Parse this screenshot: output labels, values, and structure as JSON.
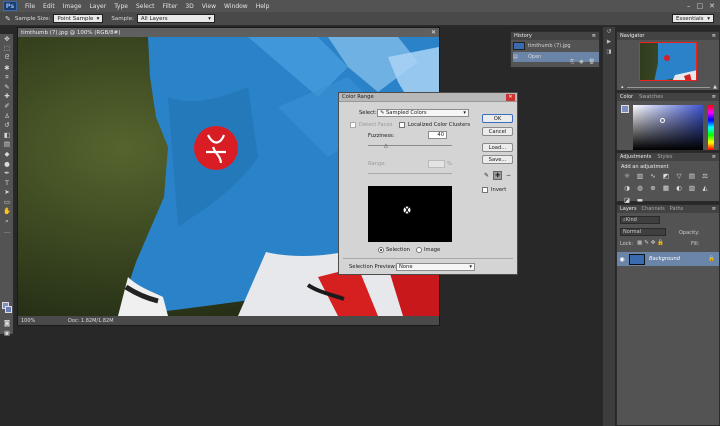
{
  "app": {
    "logo": "Ps",
    "menu": [
      "File",
      "Edit",
      "Image",
      "Layer",
      "Type",
      "Select",
      "Filter",
      "3D",
      "View",
      "Window",
      "Help"
    ]
  },
  "options": {
    "sample_size_label": "Sample Size:",
    "sample_size_value": "Point Sample",
    "sample_label": "Sample:",
    "sample_value": "All Layers",
    "workspace": "Essentials"
  },
  "document": {
    "tab_title": "timthumb (7).jpg @ 100% (RGB/8#)",
    "zoom": "100%",
    "doc_size": "Doc: 1.82M/1.82M"
  },
  "dialog": {
    "title": "Color Range",
    "select_label": "Select:",
    "select_value": "Sampled Colors",
    "detect_faces": "Detect Faces",
    "localized": "Localized Color Clusters",
    "fuzziness_label": "Fuzziness:",
    "fuzziness_value": "40",
    "range_label": "Range:",
    "range_unit": "%",
    "radio_selection": "Selection",
    "radio_image": "Image",
    "preview_label": "Selection Preview:",
    "preview_value": "None",
    "ok": "OK",
    "cancel": "Cancel",
    "load": "Load...",
    "save": "Save...",
    "invert": "Invert"
  },
  "history": {
    "tab": "History",
    "items": [
      {
        "label": "timthumb (7).jpg"
      },
      {
        "label": "Open"
      }
    ]
  },
  "navigator": {
    "tab": "Navigator"
  },
  "color": {
    "tabs": [
      "Color",
      "Swatches"
    ],
    "fg": "#7c8ec3"
  },
  "adjustments": {
    "tabs": [
      "Adjustments",
      "Styles"
    ],
    "add": "Add an adjustment"
  },
  "layers": {
    "tabs": [
      "Layers",
      "Channels",
      "Paths"
    ],
    "kind": "Kind",
    "blend": "Normal",
    "opacity": "Opacity:",
    "lock": "Lock:",
    "fill": "Fill:",
    "layer_name": "Background"
  }
}
